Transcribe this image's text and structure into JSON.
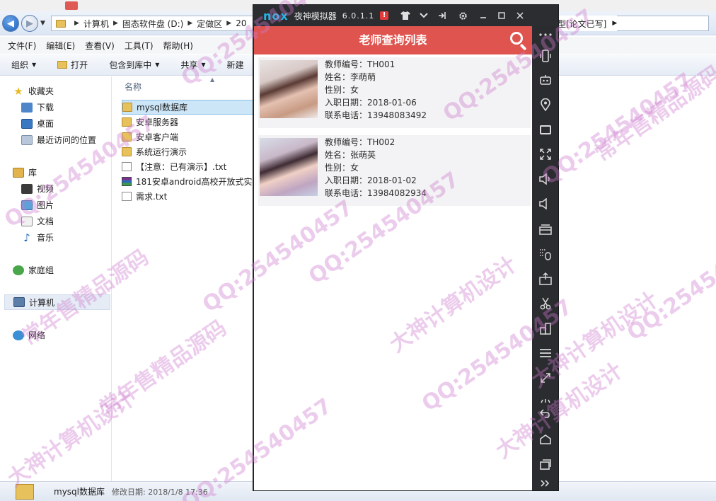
{
  "explorer": {
    "address": {
      "crumbs": [
        "计算机",
        "固态软件盘 (D:)",
        "定做区",
        "20"
      ],
      "tail": "型[论文已写]"
    },
    "menu": [
      "文件(F)",
      "编辑(E)",
      "查看(V)",
      "工具(T)",
      "帮助(H)"
    ],
    "toolbar": {
      "organize": "组织",
      "open": "打开",
      "include": "包含到库中",
      "share": "共享",
      "new": "新建"
    },
    "nav": {
      "favorites": "收藏夹",
      "downloads": "下载",
      "desktop": "桌面",
      "recent": "最近访问的位置",
      "libraries": "库",
      "videos": "视频",
      "pictures": "图片",
      "documents": "文档",
      "music": "音乐",
      "homegroup": "家庭组",
      "computer": "计算机",
      "network": "网络"
    },
    "column_name": "名称",
    "files": [
      {
        "name": "mysql数据库",
        "type": "folder"
      },
      {
        "name": "安卓服务器",
        "type": "folder"
      },
      {
        "name": "安卓客户端",
        "type": "folder"
      },
      {
        "name": "系统运行演示",
        "type": "folder"
      },
      {
        "name": "【注意：已有演示】.txt",
        "type": "txt"
      },
      {
        "name": "181安卓android高校开放式实",
        "type": "rar"
      },
      {
        "name": "需求.txt",
        "type": "txt"
      }
    ],
    "status": {
      "name": "mysql数据库",
      "meta": "修改日期: 2018/1/8 17:36"
    }
  },
  "nox": {
    "logo": "nox",
    "title": "夜神模拟器",
    "version": "6.0.1.1",
    "alert": "!"
  },
  "app": {
    "title": "老师查询列表",
    "teachers": [
      {
        "id_line": "教师编号：TH001",
        "name_line": "姓名：李萌萌",
        "gender_line": "性别：女",
        "date_line": "入职日期：2018-01-06",
        "phone_line": "联系电话：13948083492"
      },
      {
        "id_line": "教师编号：TH002",
        "name_line": "姓名：张萌英",
        "gender_line": "性别：女",
        "date_line": "入职日期：2018-01-02",
        "phone_line": "联系电话：13984082934"
      }
    ]
  },
  "watermarks": {
    "qq": "QQ:254540457",
    "a": "常年售精品源码",
    "b": "大神计算机设计"
  },
  "colors": {
    "app_bar": "#e0544f",
    "nox_logo": "#24b7e6",
    "emulator_frame": "#2a2c30"
  }
}
